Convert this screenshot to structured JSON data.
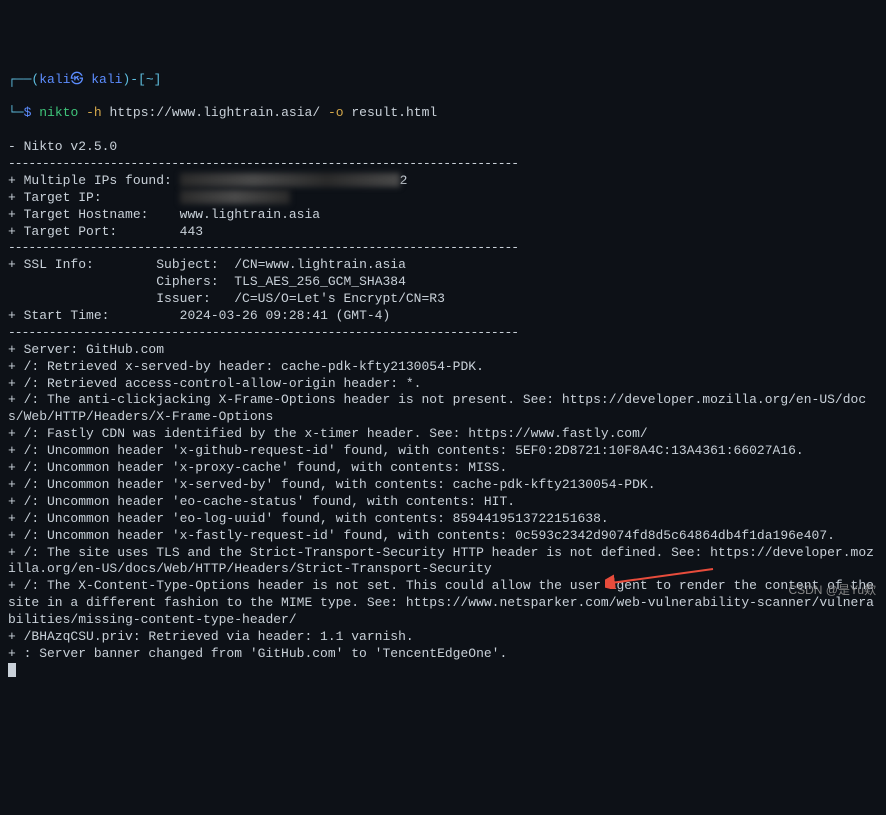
{
  "prompt": {
    "bracket_open": "┌──(",
    "user_host": "kali㉿ kali",
    "bracket_close": ")-[",
    "path": "~",
    "bracket_end": "]",
    "line2_prefix": "└─",
    "dollar": "$",
    "cmd": "nikto",
    "flag_h": "-h",
    "url": "https://www.lightrain.asia/",
    "flag_o": "-o",
    "outfile": "result.html"
  },
  "version_line": "- Nikto v2.5.0",
  "sep": "---------------------------------------------------------------------------",
  "header": {
    "multi_ip": "+ Multiple IPs found:",
    "multi_ip_tail": "2",
    "target_ip": "+ Target IP:",
    "target_host_label": "+ Target Hostname:",
    "target_host_val": "www.lightrain.asia",
    "target_port_label": "+ Target Port:",
    "target_port_val": "443"
  },
  "ssl": {
    "info_label": "+ SSL Info:",
    "subject_label": "Subject:",
    "subject_val": "/CN=www.lightrain.asia",
    "ciphers_label": "Ciphers:",
    "ciphers_val": "TLS_AES_256_GCM_SHA384",
    "issuer_label": "Issuer:",
    "issuer_val": "/C=US/O=Let's Encrypt/CN=R3"
  },
  "start_time": {
    "label": "+ Start Time:",
    "val": "2024-03-26 09:28:41 (GMT-4)"
  },
  "lines": [
    "+ Server: GitHub.com",
    "+ /: Retrieved x-served-by header: cache-pdk-kfty2130054-PDK.",
    "+ /: Retrieved access-control-allow-origin header: *.",
    "+ /: The anti-clickjacking X-Frame-Options header is not present. See: https://developer.mozilla.org/en-US/docs/Web/HTTP/Headers/X-Frame-Options",
    "+ /: Fastly CDN was identified by the x-timer header. See: https://www.fastly.com/",
    "+ /: Uncommon header 'x-github-request-id' found, with contents: 5EF0:2D8721:10F8A4C:13A4361:66027A16.",
    "+ /: Uncommon header 'x-proxy-cache' found, with contents: MISS.",
    "+ /: Uncommon header 'x-served-by' found, with contents: cache-pdk-kfty2130054-PDK.",
    "+ /: Uncommon header 'eo-cache-status' found, with contents: HIT.",
    "+ /: Uncommon header 'eo-log-uuid' found, with contents: 8594419513722151638.",
    "+ /: Uncommon header 'x-fastly-request-id' found, with contents: 0c593c2342d9074fd8d5c64864db4f1da196e407.",
    "+ /: The site uses TLS and the Strict-Transport-Security HTTP header is not defined. See: https://developer.mozilla.org/en-US/docs/Web/HTTP/Headers/Strict-Transport-Security",
    "+ /: The X-Content-Type-Options header is not set. This could allow the user agent to render the content of the site in a different fashion to the MIME type. See: https://www.netsparker.com/web-vulnerability-scanner/vulnerabilities/missing-content-type-header/",
    "+ /BHAzqCSU.priv: Retrieved via header: 1.1 varnish.",
    "+ : Server banner changed from 'GitHub.com' to 'TencentEdgeOne'."
  ],
  "watermark": "CSDN @是Yu欸"
}
